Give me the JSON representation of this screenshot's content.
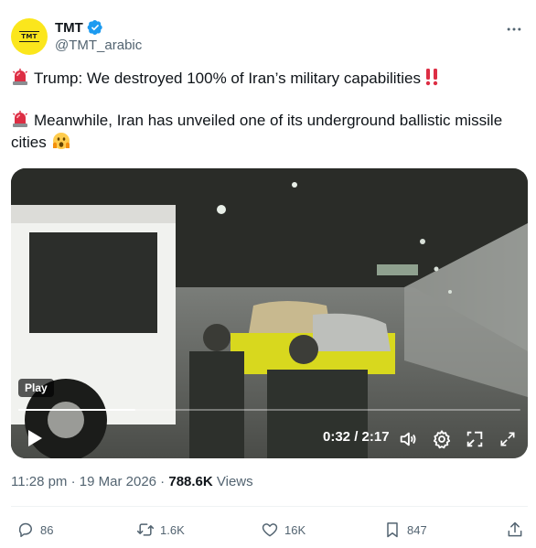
{
  "author": {
    "display_name": "TMT",
    "handle": "@TMT_arabic",
    "avatar_text": "TMT",
    "verified": true
  },
  "tweet": {
    "line1": "Trump: We destroyed 100% of Iran’s military capabilities",
    "line2a": "Meanwhile, Iran has unveiled one of its underground ballistic missile",
    "line2b": "cities",
    "emoji_siren": "siren-emoji",
    "emoji_bang": "double-exclamation-emoji",
    "emoji_face": "scared-face-emoji"
  },
  "video": {
    "play_badge": "Play",
    "time": "0:32 / 2:17",
    "progress": 0.233
  },
  "meta": {
    "time": "11:28 pm",
    "sep1": " · ",
    "date": "19 Mar 2026",
    "sep2": " · ",
    "views_count": "788.6K",
    "views_label": " Views"
  },
  "actions": {
    "replies": "86",
    "retweets": "1.6K",
    "likes": "16K",
    "bookmarks": "847"
  },
  "colors": {
    "text": "#0f1419",
    "muted": "#536471",
    "verified": "#1d9bf0",
    "avatar_bg": "#fbe61c"
  }
}
